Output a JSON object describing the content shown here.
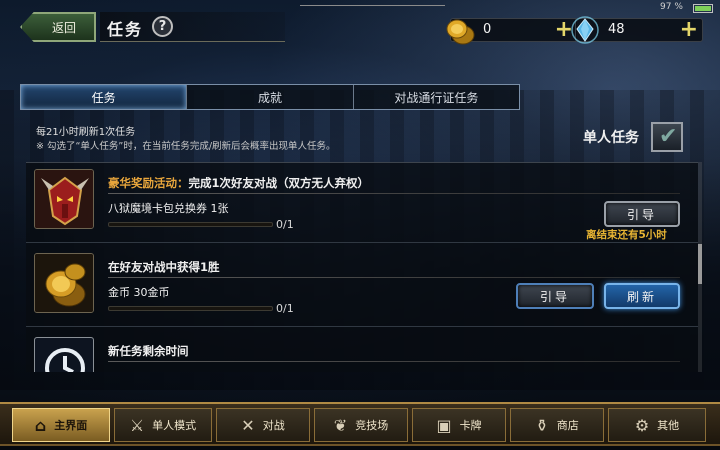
{
  "header": {
    "back_label": "返回",
    "title": "任务",
    "help_icon": "?"
  },
  "currencies": {
    "coins": {
      "icon": "gold-coin-icon",
      "value": "0",
      "plus": "+"
    },
    "gems": {
      "icon": "crystal-icon",
      "value": "48",
      "plus": "+"
    }
  },
  "status": {
    "battery": "97 %"
  },
  "tabs": [
    {
      "label": "任务",
      "active": true
    },
    {
      "label": "成就",
      "active": false
    },
    {
      "label": "对战通行证任务",
      "active": false
    }
  ],
  "notice": {
    "line1": "每21小时刷新1次任务",
    "line2": "※ 勾选了“单人任务”时，在当前任务完成/刷新后会概率出现单人任务。"
  },
  "solo": {
    "label": "单人任务",
    "checked": true
  },
  "tasks": [
    {
      "title_highlight": "豪华奖励活动：",
      "title": "完成1次好友对战（双方无人弃权）",
      "reward": "八狱魔境卡包兑换券 1张",
      "progress_text": "0/1",
      "progress": 0,
      "guide_label": "引导",
      "countdown": "离结束还有5小时"
    },
    {
      "title": "在好友对战中获得1胜",
      "reward": "金币 30金币",
      "progress_text": "0/1",
      "progress": 0,
      "guide_label": "引导",
      "refresh_label": "刷新"
    },
    {
      "title": "新任务剩余时间"
    }
  ],
  "nav": [
    {
      "label": "主界面",
      "icon": "home-icon",
      "active": true
    },
    {
      "label": "单人模式",
      "icon": "sword-shield-icon",
      "active": false
    },
    {
      "label": "对战",
      "icon": "crossed-swords-icon",
      "active": false
    },
    {
      "label": "竞技场",
      "icon": "laurel-icon",
      "active": false
    },
    {
      "label": "卡牌",
      "icon": "cards-icon",
      "active": false
    },
    {
      "label": "商店",
      "icon": "shop-icon",
      "active": false
    },
    {
      "label": "其他",
      "icon": "gears-icon",
      "active": false
    }
  ]
}
